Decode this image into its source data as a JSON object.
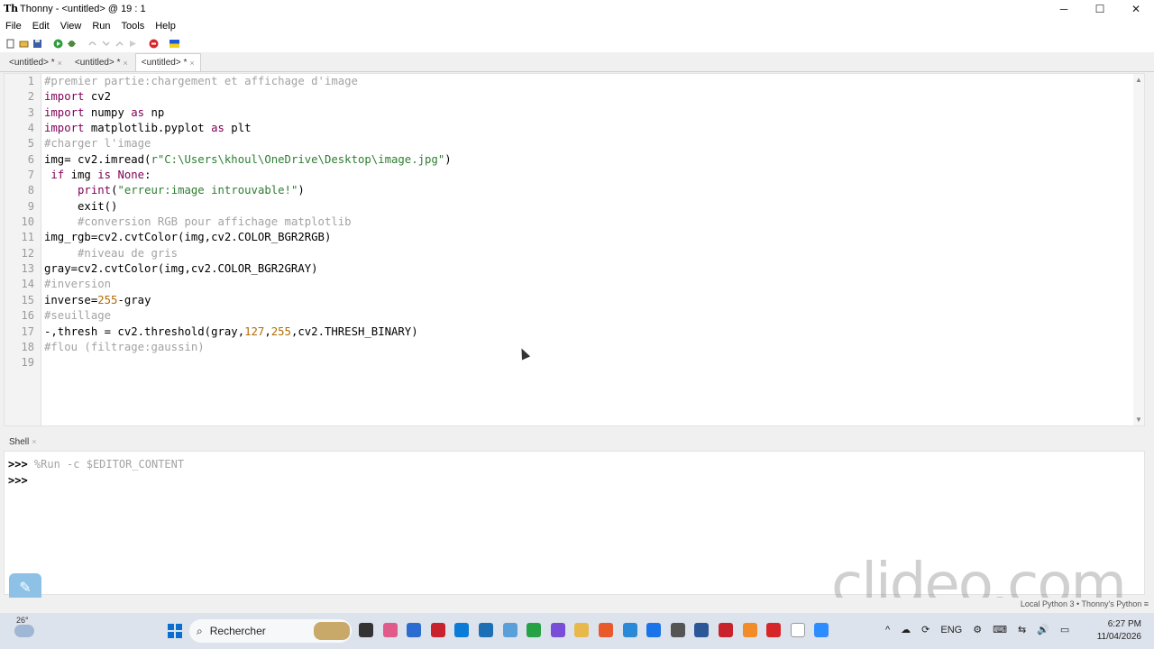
{
  "window": {
    "title": "Thonny  -  <untitled>  @  19 : 1",
    "app_icon": "Th",
    "controls": [
      "─",
      "☐",
      "✕"
    ]
  },
  "menu": [
    "File",
    "Edit",
    "View",
    "Run",
    "Tools",
    "Help"
  ],
  "toolbar_icons": [
    "new-file-icon",
    "open-file-icon",
    "save-icon",
    "run-icon",
    "debug-icon",
    "step-over-icon",
    "step-into-icon",
    "step-out-icon",
    "resume-icon",
    "stop-icon",
    "ukraine-flag-icon"
  ],
  "editor_tabs": [
    {
      "label": "<untitled> *",
      "close": "×"
    },
    {
      "label": "<untitled> *",
      "close": "×"
    },
    {
      "label": "<untitled> *",
      "close": "×"
    }
  ],
  "editor": {
    "line_numbers": [
      "1",
      "2",
      "3",
      "4",
      "5",
      "6",
      "7",
      "8",
      "9",
      "10",
      "11",
      "12",
      "13",
      "14",
      "15",
      "16",
      "17",
      "18",
      "19"
    ]
  },
  "shell": {
    "tab_label": "Shell",
    "tab_close": "×",
    "prompt": ">>>",
    "command": "%Run -c $EDITOR_CONTENT"
  },
  "status": {
    "interpreter": "Local Python 3  •  Thonny's Python",
    "menu_glyph": "≡"
  },
  "watermark": "clideo.com",
  "taskbar": {
    "temperature": "26°",
    "search_placeholder": "Rechercher",
    "time": "6:27 PM",
    "date": "11/04/2026",
    "tray_glyphs": [
      "^",
      "☁",
      "⟳",
      "ENG",
      "⚙",
      "⌨",
      "⇆",
      "🔊",
      "▭"
    ]
  },
  "colors": {
    "comment": "#a3a3a3",
    "keyword": "#7f0055",
    "string": "#2e7d32",
    "number": "#b36b00"
  }
}
